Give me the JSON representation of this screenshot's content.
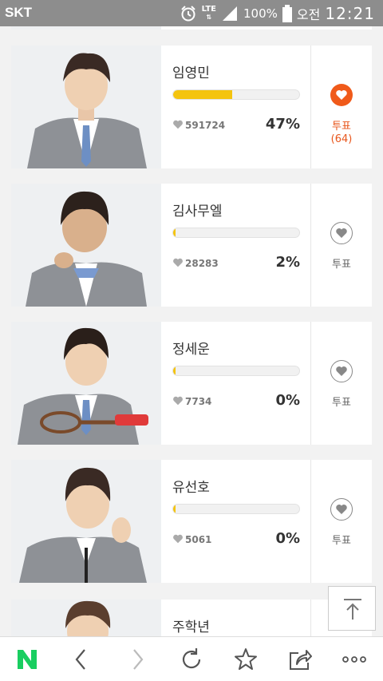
{
  "status_bar": {
    "carrier": "SKT",
    "network": "LTE",
    "battery": "100%",
    "ampm": "오전",
    "time": "12:21"
  },
  "cards": [
    {
      "name": "임영민",
      "votes": "591724",
      "percent": "47%",
      "fill": 0.47,
      "vote_label": "투표",
      "vote_count": "(64)",
      "voted": true
    },
    {
      "name": "김사무엘",
      "votes": "28283",
      "percent": "2%",
      "fill": 0.02,
      "vote_label": "투표",
      "vote_count": "",
      "voted": false
    },
    {
      "name": "정세운",
      "votes": "7734",
      "percent": "0%",
      "fill": 0.0,
      "vote_label": "투표",
      "vote_count": "",
      "voted": false
    },
    {
      "name": "유선호",
      "votes": "5061",
      "percent": "0%",
      "fill": 0.0,
      "vote_label": "투표",
      "vote_count": "",
      "voted": false
    }
  ],
  "partial_card": {
    "name": "주학년"
  },
  "colors": {
    "accent": "#f05a1a",
    "bar_fill": "#f4c40f",
    "naver_green": "#19ce60"
  },
  "bottom_nav": [
    "naver-home-icon",
    "back-icon",
    "forward-icon",
    "refresh-icon",
    "bookmark-star-icon",
    "share-icon",
    "more-icon"
  ]
}
